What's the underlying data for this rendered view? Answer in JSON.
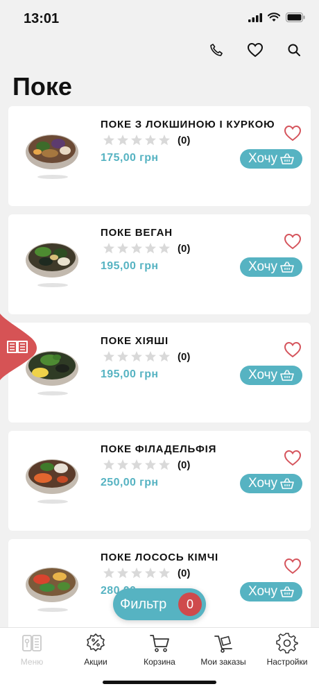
{
  "status": {
    "time": "13:01"
  },
  "page": {
    "title": "Поке"
  },
  "products": [
    {
      "name": "ПОКЕ З ЛОКШИНОЮ І КУРКОЮ",
      "rating_count": "(0)",
      "price": "175,00 грн",
      "want_label": "Хочу"
    },
    {
      "name": "ПОКЕ ВЕГАН",
      "rating_count": "(0)",
      "price": "195,00 грн",
      "want_label": "Хочу"
    },
    {
      "name": "ПОКЕ ХІЯШІ",
      "rating_count": "(0)",
      "price": "195,00 грн",
      "want_label": "Хочу"
    },
    {
      "name": "ПОКЕ ФІЛАДЕЛЬФІЯ",
      "rating_count": "(0)",
      "price": "250,00 грн",
      "want_label": "Хочу"
    },
    {
      "name": "ПОКЕ ЛОСОСЬ КІМЧІ",
      "rating_count": "(0)",
      "price": "280,00",
      "want_label": "Хочу"
    }
  ],
  "filter": {
    "label": "Фильтр",
    "count": "0"
  },
  "tabbar": {
    "menu": "Меню",
    "promos": "Акции",
    "cart": "Корзина",
    "orders": "Мои заказы",
    "settings": "Настройки"
  },
  "colors": {
    "accent": "#56b3c2",
    "heart": "#d5545c",
    "badge": "#cf4a4c",
    "menu_tab": "#d65355",
    "star": "#d9d9d9"
  },
  "icons": [
    "phone-icon",
    "heart-icon",
    "search-icon",
    "cart-add-icon",
    "menu-book-icon",
    "percent-badge-icon",
    "cart-icon",
    "dolly-icon",
    "gear-icon"
  ]
}
